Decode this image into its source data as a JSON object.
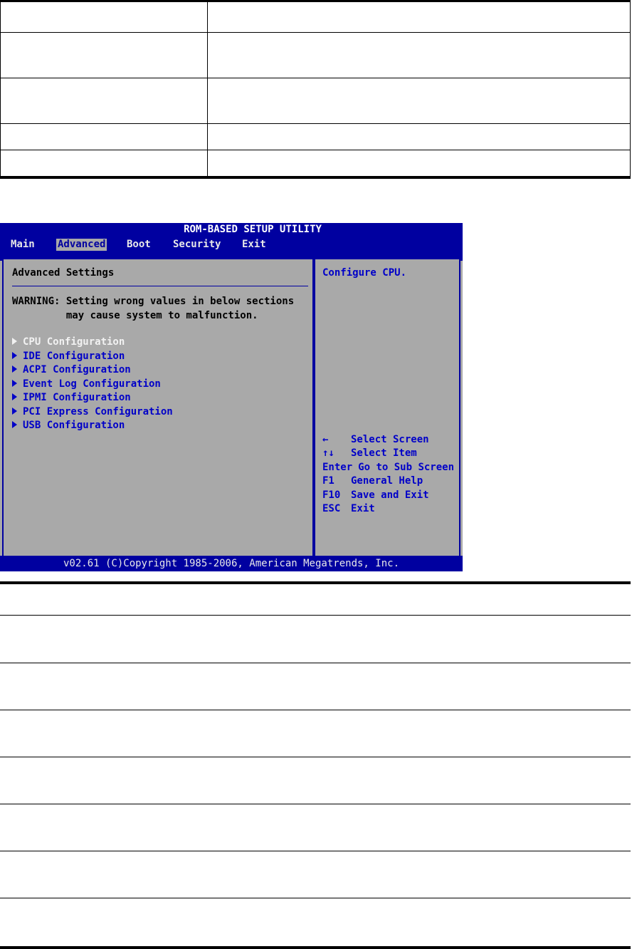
{
  "bios": {
    "title": "ROM-BASED SETUP UTILITY",
    "menu": [
      "Main",
      "Advanced",
      "Boot",
      "Security",
      "Exit"
    ],
    "active_menu": "Advanced",
    "section_title": "Advanced Settings",
    "warning": "WARNING: Setting wrong values in below sections\n         may cause system to malfunction.",
    "submenu": [
      "CPU Configuration",
      "IDE Configuration",
      "ACPI Configuration",
      "Event Log Configuration",
      "IPMI Configuration",
      "PCI Express Configuration",
      "USB Configuration"
    ],
    "selected_submenu": "CPU Configuration",
    "help_text": "Configure CPU.",
    "keys": [
      {
        "key": "←",
        "desc": "Select Screen"
      },
      {
        "key": "↑↓",
        "desc": "Select Item"
      },
      {
        "key": "Enter",
        "desc": "Go to Sub Screen"
      },
      {
        "key": "F1",
        "desc": "General Help"
      },
      {
        "key": "F10",
        "desc": "Save and Exit"
      },
      {
        "key": "ESC",
        "desc": "Exit"
      }
    ],
    "footer": "v02.61 (C)Copyright 1985-2006, American Megatrends, Inc.",
    "colors": {
      "header_blue": "#0000a0",
      "panel_gray": "#a9a9a9",
      "text_blue": "#0000c8",
      "highlight": "#f2f2f2"
    }
  }
}
